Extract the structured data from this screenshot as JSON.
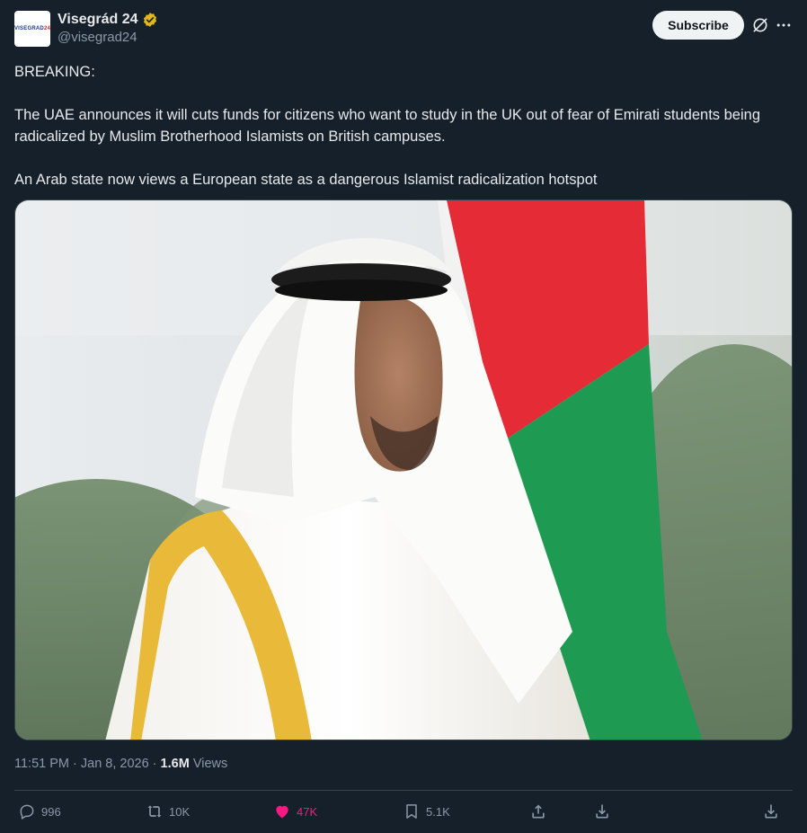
{
  "author": {
    "avatar_text_main": "VISEGRAD",
    "avatar_text_num": "24",
    "display_name": "Visegrád 24",
    "handle": "@visegrad24",
    "verified_icon": "verified-badge-icon"
  },
  "header": {
    "subscribe_label": "Subscribe"
  },
  "tweet": {
    "line1": "BREAKING:",
    "line2": "The UAE announces it will cuts funds for citizens who want to study in the UK out of fear of Emirati students being radicalized by Muslim Brotherhood Islamists on British campuses.",
    "line3": "An Arab state now views a European state as a dangerous Islamist radicalization hotspot"
  },
  "meta": {
    "time": "11:51 PM · Jan 8, 2026 · ",
    "views_count": "1.6M",
    "views_label": " Views"
  },
  "actions": {
    "replies": "996",
    "reposts": "10K",
    "likes": "47K",
    "bookmarks": "5.1K"
  },
  "colors": {
    "background": "#15202b",
    "like_active": "#f91880",
    "verified_gold": "#e2b719",
    "flag_red": "#e52b36",
    "flag_green": "#1e9a52"
  }
}
